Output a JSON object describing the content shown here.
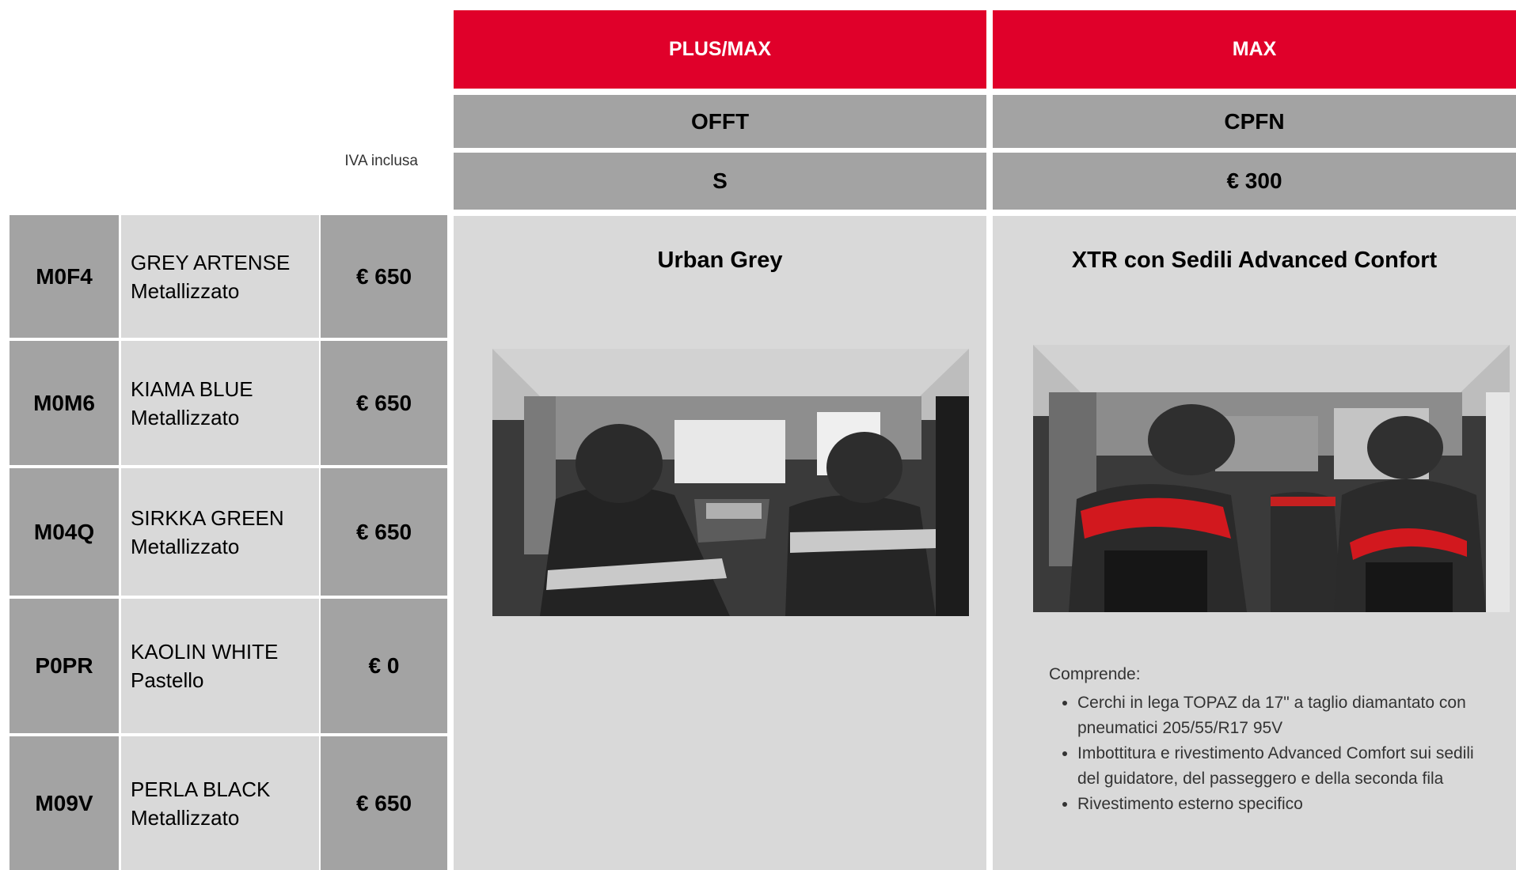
{
  "header": {
    "col1_label": "PLUS/MAX",
    "col2_label": "MAX",
    "col1_code": "OFFT",
    "col2_code": "CPFN",
    "col1_price": "S",
    "col2_price": "€ 300",
    "vat_note": "IVA inclusa"
  },
  "colors": [
    {
      "code": "M0F4",
      "name": "GREY ARTENSE",
      "finish": "Metallizzato",
      "price": "€ 650"
    },
    {
      "code": "M0M6",
      "name": "KIAMA BLUE",
      "finish": "Metallizzato",
      "price": "€ 650"
    },
    {
      "code": "M04Q",
      "name": "SIRKKA GREEN",
      "finish": "Metallizzato",
      "price": "€ 650"
    },
    {
      "code": "P0PR",
      "name": "KAOLIN WHITE",
      "finish": "Pastello",
      "price": "€ 0"
    },
    {
      "code": "M09V",
      "name": "PERLA BLACK",
      "finish": "Metallizzato",
      "price": "€ 650"
    }
  ],
  "interiors": {
    "col1_title": "Urban Grey",
    "col2_title": "XTR con Sedili Advanced Confort",
    "includes_label": "Comprende:",
    "includes_items": [
      "Cerchi in lega TOPAZ da 17\" a taglio diamantato con pneumatici 205/55/R17 95V",
      "Imbottitura e rivestimento Advanced Comfort sui sedili del guidatore, del passeggero e della seconda fila",
      "Rivestimento esterno specifico"
    ]
  },
  "theme": {
    "accent_red": "#e0002a",
    "header_grey": "#a3a3a3",
    "cell_light_grey": "#d9d9d9"
  }
}
